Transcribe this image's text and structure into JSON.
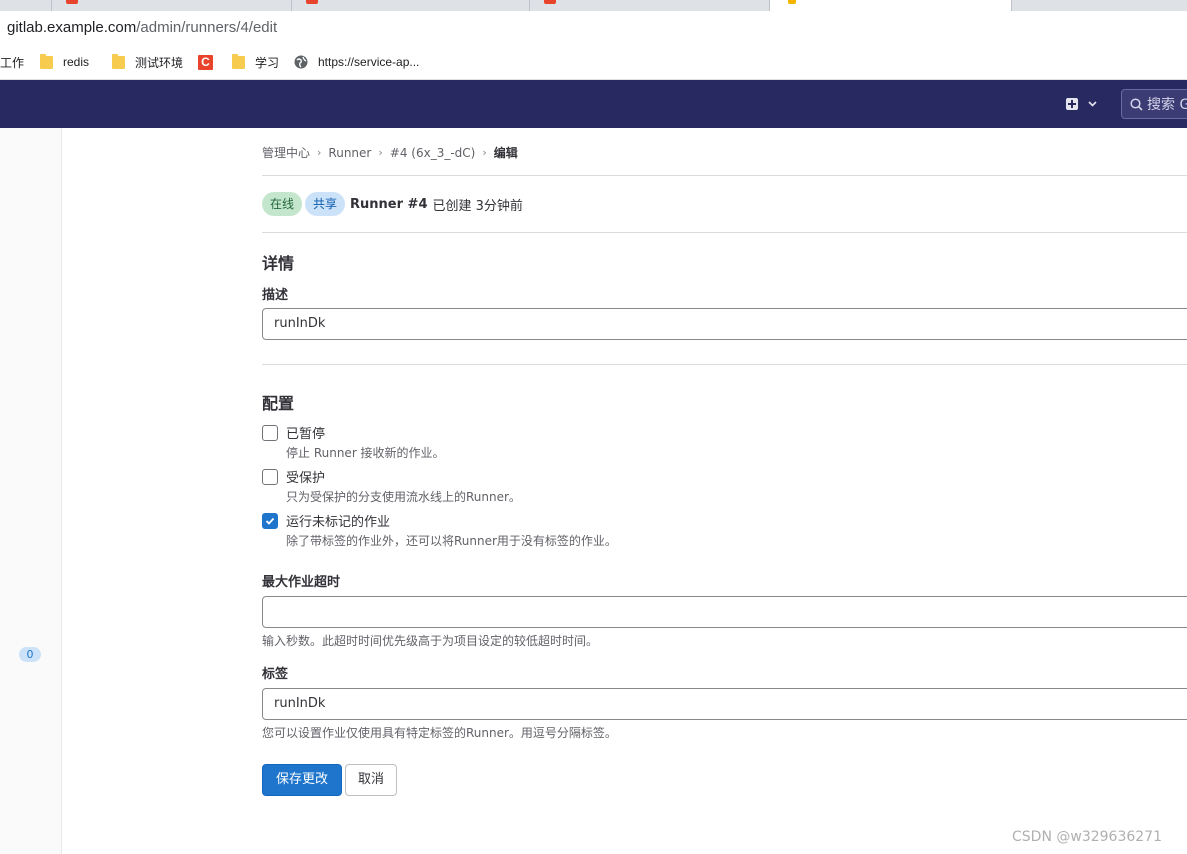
{
  "browser": {
    "url_host": "gitlab.example.com",
    "url_path": "/admin/runners/4/edit",
    "bookmarks": [
      {
        "label": "工作",
        "icon": "folder-icon"
      },
      {
        "label": "redis",
        "icon": "folder-icon"
      },
      {
        "label": "测试环境",
        "icon": "folder-icon"
      },
      {
        "label": "C",
        "icon": "csdn-icon"
      },
      {
        "label": "学习",
        "icon": "folder-icon"
      },
      {
        "label": "https://service-ap...",
        "icon": "globe-icon"
      }
    ]
  },
  "header": {
    "search_placeholder": "搜索 G"
  },
  "sidebar": {
    "count": "0"
  },
  "breadcrumb": {
    "items": [
      "管理中心",
      "Runner",
      "#4 (6x_3_-dC)",
      "编辑"
    ]
  },
  "runner": {
    "status_online": "在线",
    "status_shared": "共享",
    "name": "Runner #4",
    "created": "已创建 3分钟前"
  },
  "details": {
    "heading": "详情",
    "description_label": "描述",
    "description_value": "runInDk"
  },
  "config": {
    "heading": "配置",
    "options": [
      {
        "label": "已暂停",
        "help": "停止 Runner 接收新的作业。",
        "checked": false
      },
      {
        "label": "受保护",
        "help": "只为受保护的分支使用流水线上的Runner。",
        "checked": false
      },
      {
        "label": "运行未标记的作业",
        "help": "除了带标签的作业外，还可以将Runner用于没有标签的作业。",
        "checked": true
      }
    ],
    "timeout_label": "最大作业超时",
    "timeout_value": "",
    "timeout_help": "输入秒数。此超时时间优先级高于为项目设定的较低超时时间。",
    "tags_label": "标签",
    "tags_value": "runInDk",
    "tags_help": "您可以设置作业仅使用具有特定标签的Runner。用逗号分隔标签。"
  },
  "actions": {
    "save_label": "保存更改",
    "cancel_label": "取消"
  },
  "watermark": "CSDN @w329636271",
  "colors": {
    "header_bg": "#292961",
    "primary": "#1f75cb",
    "online_badge": "#c3e6cd",
    "shared_badge": "#cbe2f9"
  }
}
